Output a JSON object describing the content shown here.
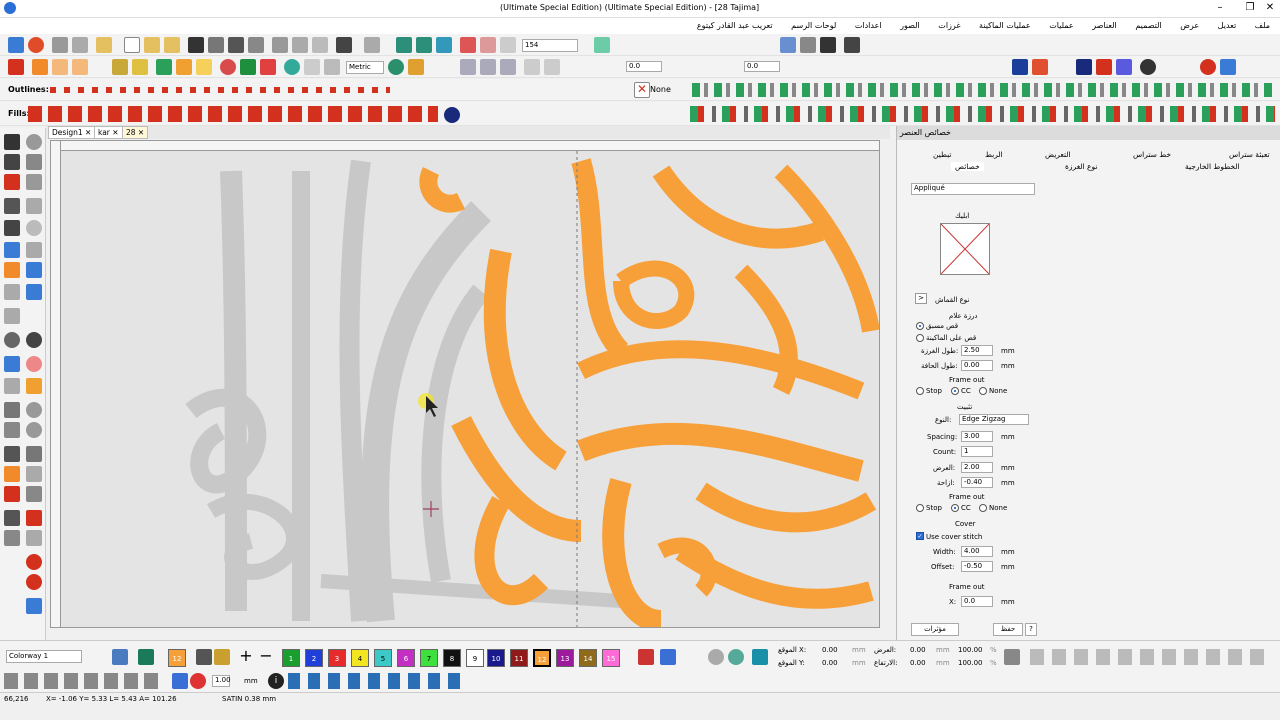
{
  "titlebar": {
    "title": "(Ultimate Special Edition) (Ultimate Special Edition) - [28       Tajima]"
  },
  "menu": [
    "ملف",
    "تعديل",
    "عرض",
    "التصميم",
    "العناصر",
    "عمليات",
    "عمليات الماكينة",
    "غرزات",
    "الصور",
    "اعدادات",
    "لوحات الرسم",
    "تعريب عبد القادر كيتوع"
  ],
  "toolbar": {
    "zoom_value": "154",
    "units": "Metric",
    "outlines_label": "Outlines:",
    "fills_label": "Fills:",
    "none_label": "None",
    "stitch_value_1": "0.0",
    "stitch_value_2": "0.0"
  },
  "tabs": [
    "Design1",
    "kar",
    "28"
  ],
  "panel": {
    "header": "خصائص العنصر",
    "tabs_row1": [
      "تعبئة ستراس",
      "خط ستراس",
      "التعريض",
      "الربط",
      "تبطين"
    ],
    "tabs_row2": [
      "الخطوط الخارجية",
      "نوع الغرزة",
      "خصائص"
    ],
    "type_select": "Appliqué",
    "applique_label": "ابليك",
    "fabric_type_label": "نوع القماش",
    "cut_mark_label": "درزة علام",
    "radio_precut": "قص مسبق",
    "radio_machine_cut": "قص على الماكينة",
    "stitch_length_label": "طول الغرزة:",
    "stitch_length": "2.50",
    "edge_length_label": "طول الحافة:",
    "edge_length": "0.00",
    "mm": "mm",
    "frame_out_label": "Frame out",
    "stop": "Stop",
    "cc": "CC",
    "none": "None",
    "tack_label": "تثبيت",
    "type_label": "النوع:",
    "tack_type": "Edge Zigzag",
    "spacing_label": "Spacing:",
    "spacing": "3.00",
    "count_label": "Count:",
    "count": "1",
    "width_label_ar": "العرض:",
    "width_ar": "2.00",
    "offset_label_ar": "ازاحة:",
    "offset_ar": "-0.40",
    "frame_out_label2": "Frame out",
    "cover_label": "Cover",
    "use_cover": "Use cover stitch",
    "width_label": "Width:",
    "width": "4.00",
    "offset_label": "Offset:",
    "offset": "-0.50",
    "frame_out_label3": "Frame out",
    "x_label": "X:",
    "x_value": "0.0",
    "btn_effects": "مؤثرات",
    "btn_save": "حفظ",
    "btn_help": "?"
  },
  "colorbar": {
    "colorway": "Colorway 1",
    "swatches": [
      {
        "n": "12",
        "c": "#f7a03a"
      },
      {
        "n": "1",
        "c": "#1a9e2e"
      },
      {
        "n": "2",
        "c": "#1f3fd8"
      },
      {
        "n": "3",
        "c": "#e52b2b"
      },
      {
        "n": "4",
        "c": "#f4e521"
      },
      {
        "n": "5",
        "c": "#3ec9c9"
      },
      {
        "n": "6",
        "c": "#c22fc2"
      },
      {
        "n": "7",
        "c": "#3ee03e"
      },
      {
        "n": "8",
        "c": "#111111"
      },
      {
        "n": "9",
        "c": "#ffffff"
      },
      {
        "n": "10",
        "c": "#1a1a8e"
      },
      {
        "n": "11",
        "c": "#8e1a1a"
      },
      {
        "n": "12",
        "c": "#f7a03a"
      },
      {
        "n": "13",
        "c": "#9c1a9c"
      },
      {
        "n": "14",
        "c": "#8e6a1a"
      },
      {
        "n": "15",
        "c": "#ff6ad5"
      }
    ],
    "pos_x_label": "الموقع X:",
    "pos_y_label": "الموقع Y:",
    "pos_x": "0.00",
    "pos_y": "0.00",
    "w_label": "العرض:",
    "h_label": "الارتفاع:",
    "w": "0.00",
    "h": "0.00",
    "pct1": "100.00",
    "pct2": "100.00",
    "mm": "mm",
    "pct": "%"
  },
  "bottombar": {
    "stitch_len": "1.00",
    "mm": "mm"
  },
  "status": {
    "count": "66,216",
    "coords": "X= -1.06 Y= 5.33 L= 5.43 A= 101.26",
    "stitch": "SATIN  0.38 mm"
  },
  "colors": {
    "orange": "#f7a03a",
    "grey_stitch": "#c8c8c8"
  }
}
